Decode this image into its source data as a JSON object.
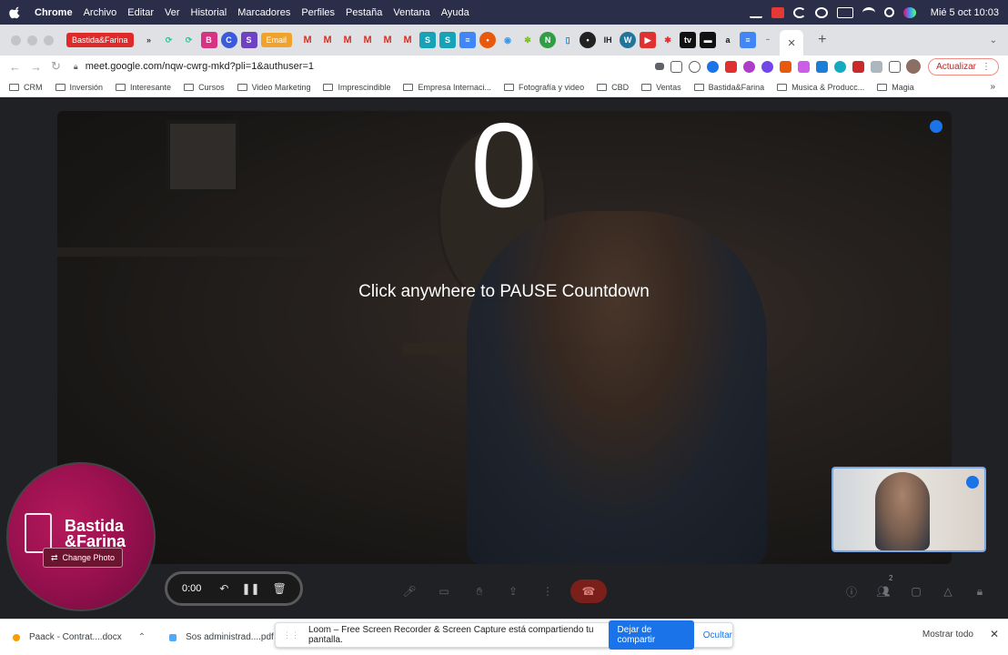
{
  "menubar": {
    "app_name": "Chrome",
    "items": [
      "Archivo",
      "Editar",
      "Ver",
      "Historial",
      "Marcadores",
      "Perfiles",
      "Pestaña",
      "Ventana",
      "Ayuda"
    ],
    "clock": "Mié 5 oct  10:03"
  },
  "tabs": {
    "first_label": "Bastida&Farina",
    "email_label": "Email",
    "close_icon": "✕"
  },
  "address": {
    "url": "meet.google.com/nqw-cwrg-mkd?pli=1&authuser=1",
    "update_label": "Actualizar"
  },
  "bookmarks": [
    "CRM",
    "Inversión",
    "Interesante",
    "Cursos",
    "Video Marketing",
    "Imprescindible",
    "Empresa Internaci...",
    "Fotografía y video",
    "CBD",
    "Ventas",
    "Bastida&Farina",
    "Musica & Producc...",
    "Magia"
  ],
  "meet": {
    "countdown_value": "0",
    "countdown_hint": "Click anywhere to PAUSE Countdown",
    "participant_count": "2"
  },
  "loom": {
    "timer": "0:00",
    "brand_name_line1": "Bastida",
    "brand_name_line2": "&Farina",
    "change_photo": "Change Photo"
  },
  "shelf": {
    "download1": "Paack - Contrat....docx",
    "download2": "Sos administrad....pdf",
    "share_text": "Loom – Free Screen Recorder & Screen Capture está compartiendo tu pantalla.",
    "stop_share": "Dejar de compartir",
    "hide": "Ocultar",
    "show_all": "Mostrar todo"
  },
  "colors": {
    "brand_magenta": "#9b1150",
    "meet_bg": "#202124",
    "accent_blue": "#1a73e8"
  }
}
